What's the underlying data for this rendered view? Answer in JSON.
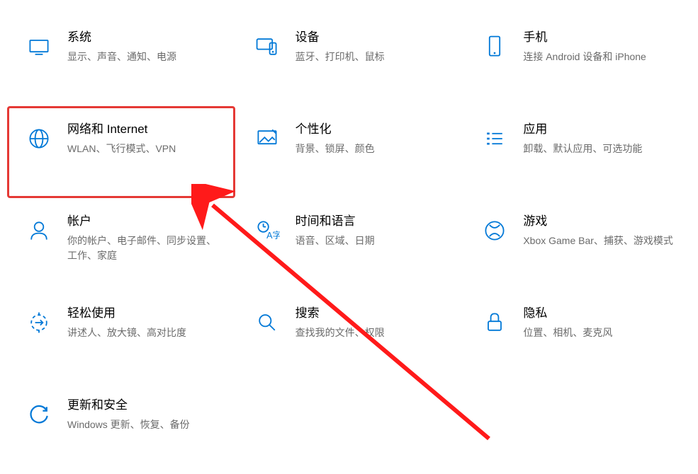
{
  "tiles": [
    {
      "id": "system",
      "title": "系统",
      "subtitle": "显示、声音、通知、电源",
      "highlight": false
    },
    {
      "id": "devices",
      "title": "设备",
      "subtitle": "蓝牙、打印机、鼠标",
      "highlight": false
    },
    {
      "id": "phone",
      "title": "手机",
      "subtitle": "连接 Android 设备和 iPhone",
      "highlight": false
    },
    {
      "id": "network",
      "title": "网络和 Internet",
      "subtitle": "WLAN、飞行模式、VPN",
      "highlight": true
    },
    {
      "id": "personal",
      "title": "个性化",
      "subtitle": "背景、锁屏、颜色",
      "highlight": false
    },
    {
      "id": "apps",
      "title": "应用",
      "subtitle": "卸载、默认应用、可选功能",
      "highlight": false
    },
    {
      "id": "accounts",
      "title": "帐户",
      "subtitle": "你的帐户、电子邮件、同步设置、工作、家庭",
      "highlight": false
    },
    {
      "id": "time",
      "title": "时间和语言",
      "subtitle": "语音、区域、日期",
      "highlight": false
    },
    {
      "id": "gaming",
      "title": "游戏",
      "subtitle": "Xbox Game Bar、捕获、游戏模式",
      "highlight": false
    },
    {
      "id": "ease",
      "title": "轻松使用",
      "subtitle": "讲述人、放大镜、高对比度",
      "highlight": false
    },
    {
      "id": "search",
      "title": "搜索",
      "subtitle": "查找我的文件、权限",
      "highlight": false
    },
    {
      "id": "privacy",
      "title": "隐私",
      "subtitle": "位置、相机、麦克风",
      "highlight": false
    },
    {
      "id": "update",
      "title": "更新和安全",
      "subtitle": "Windows 更新、恢复、备份",
      "highlight": false
    }
  ],
  "colors": {
    "accent": "#0078d7",
    "highlight": "#e53935"
  }
}
